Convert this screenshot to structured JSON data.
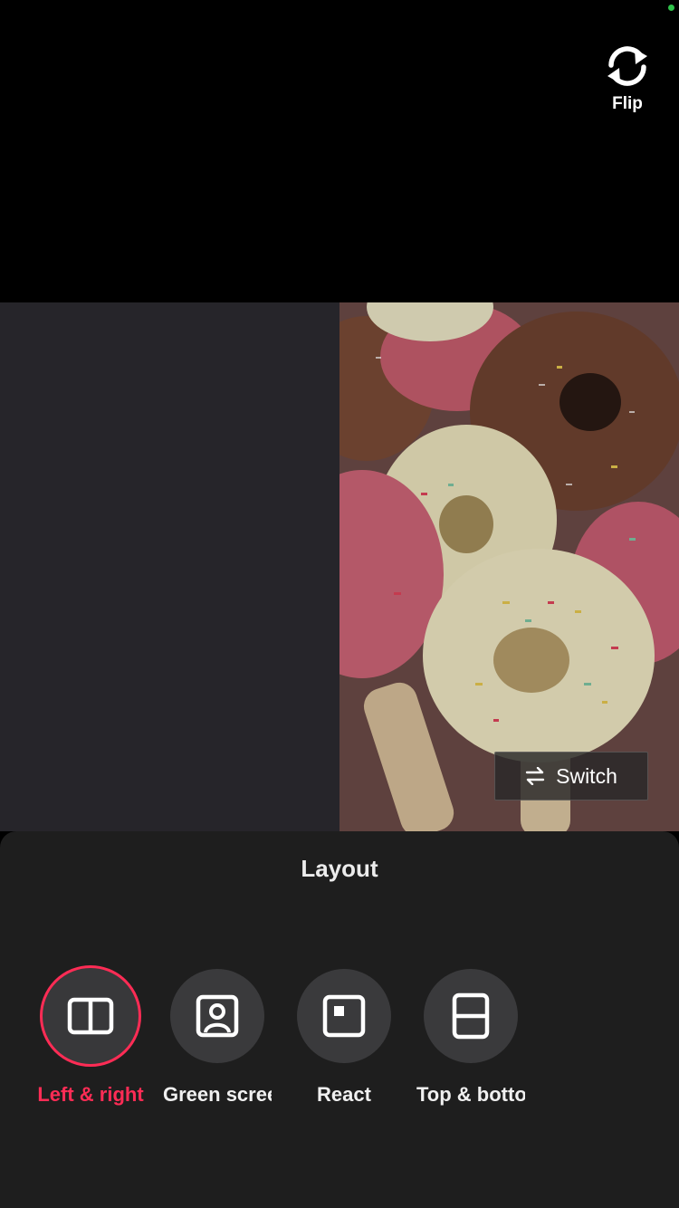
{
  "camera": {
    "flip_label": "Flip"
  },
  "stage": {
    "switch_label": "Switch"
  },
  "layout_sheet": {
    "title": "Layout",
    "options": [
      {
        "label": "Left & right",
        "icon": "split-left-right-icon",
        "selected": true
      },
      {
        "label": "Green screen",
        "icon": "green-screen-icon",
        "selected": false
      },
      {
        "label": "React",
        "icon": "react-icon",
        "selected": false
      },
      {
        "label": "Top & bottom",
        "icon": "split-top-bottom-icon",
        "selected": false
      }
    ]
  },
  "colors": {
    "accent": "#fe2c55",
    "sheet_bg": "#1e1e1e",
    "option_bg": "#3a3a3c",
    "left_pane": "#26252a"
  }
}
